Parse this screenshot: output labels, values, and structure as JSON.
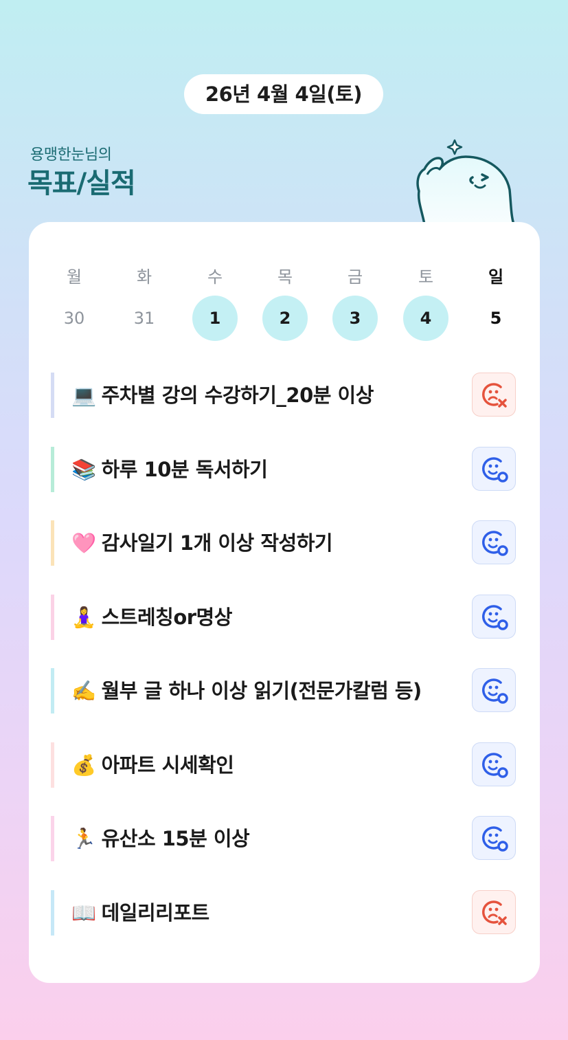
{
  "date_label": "26년 4월 4일(토)",
  "brand": {
    "subtitle": "용맹한눈님의",
    "title": "목표/실적"
  },
  "week": {
    "days": [
      "월",
      "화",
      "수",
      "목",
      "금",
      "토",
      "일"
    ],
    "dates": [
      "30",
      "31",
      "1",
      "2",
      "3",
      "4",
      "5"
    ],
    "completed": [
      false,
      false,
      true,
      true,
      true,
      true,
      false
    ]
  },
  "goals": [
    {
      "emoji": "💻",
      "label": "주차별 강의 수강하기_20분 이상",
      "status": "fail",
      "accent": "#d5dcf4"
    },
    {
      "emoji": "📚",
      "label": "하루 10분 독서하기",
      "status": "success",
      "accent": "#b7ecd8"
    },
    {
      "emoji": "🩷",
      "label": "감사일기 1개 이상 작성하기",
      "status": "success",
      "accent": "#fbe3b8"
    },
    {
      "emoji": "🧘‍♀️",
      "label": "스트레칭or명상",
      "status": "success",
      "accent": "#fbd2e6"
    },
    {
      "emoji": "✍️",
      "label": "월부 글 하나 이상 읽기(전문가칼럼 등)",
      "status": "success",
      "accent": "#c2ecf3"
    },
    {
      "emoji": "💰",
      "label": "아파트 시세확인",
      "status": "success",
      "accent": "#fde0e0"
    },
    {
      "emoji": "🏃",
      "label": "유산소 15분 이상",
      "status": "success",
      "accent": "#fbd4ea"
    },
    {
      "emoji": "📖",
      "label": "데일리리포트",
      "status": "fail",
      "accent": "#c6e8f7"
    }
  ],
  "colors": {
    "brand": "#1a6b72",
    "success": "#2f5fe8",
    "fail": "#e5533d",
    "completed_day": "#c4f0f4"
  }
}
